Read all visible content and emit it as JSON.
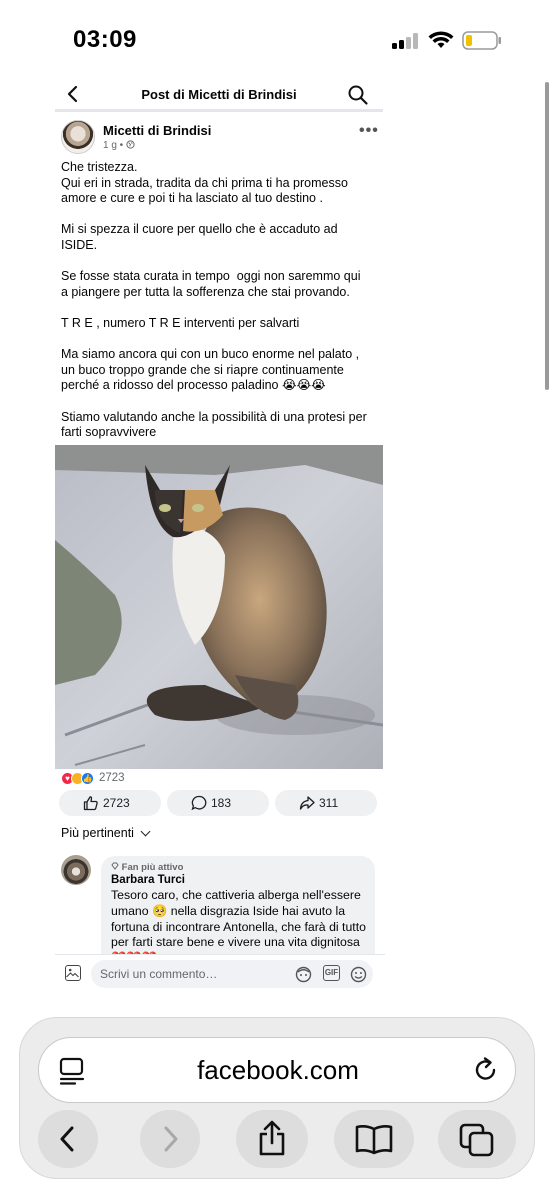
{
  "status_bar": {
    "time": "03:09"
  },
  "header": {
    "title": "Post di Micetti di Brindisi"
  },
  "post": {
    "author": "Micetti di Brindisi",
    "meta": "1 g • ",
    "text": "Che tristezza.\nQui eri in strada, tradita da chi prima ti ha promesso\namore e cure e poi ti ha lasciato al tuo destino .\n\nMi si spezza il cuore per quello che è accaduto ad\nISIDE.\n\nSe fosse stata curata in tempo  oggi non saremmo qui\na piangere per tutta la sofferenza che stai provando.\n\nT R E , numero T R E interventi per salvarti\n\nMa siamo ancora qui con un buco enorme nel palato ,\nun buco troppo grande che si riapre continuamente\nperché a ridosso del processo paladino 😭😭😭\n\nStiamo valutando anche la possibilità di una protesi per\nfarti sopravvivere",
    "reaction_count": "2723",
    "like_count": "2723",
    "comment_count": "183",
    "share_count": "311"
  },
  "comments": {
    "sort_label": "Più pertinenti",
    "first": {
      "badge": "Fan più attivo",
      "author": "Barbara Turci",
      "text": "Tesoro caro, che cattiveria alberga nell'essere umano 🥺 nella disgrazia Iside hai avuto la fortuna di incontrare Antonella, che farà di tutto per farti stare bene e vivere una vita dignitosa ❤️❤️❤️"
    },
    "composer_placeholder": "Scrivi un commento…",
    "gif_label": "GIF"
  },
  "browser": {
    "url": "facebook.com"
  }
}
